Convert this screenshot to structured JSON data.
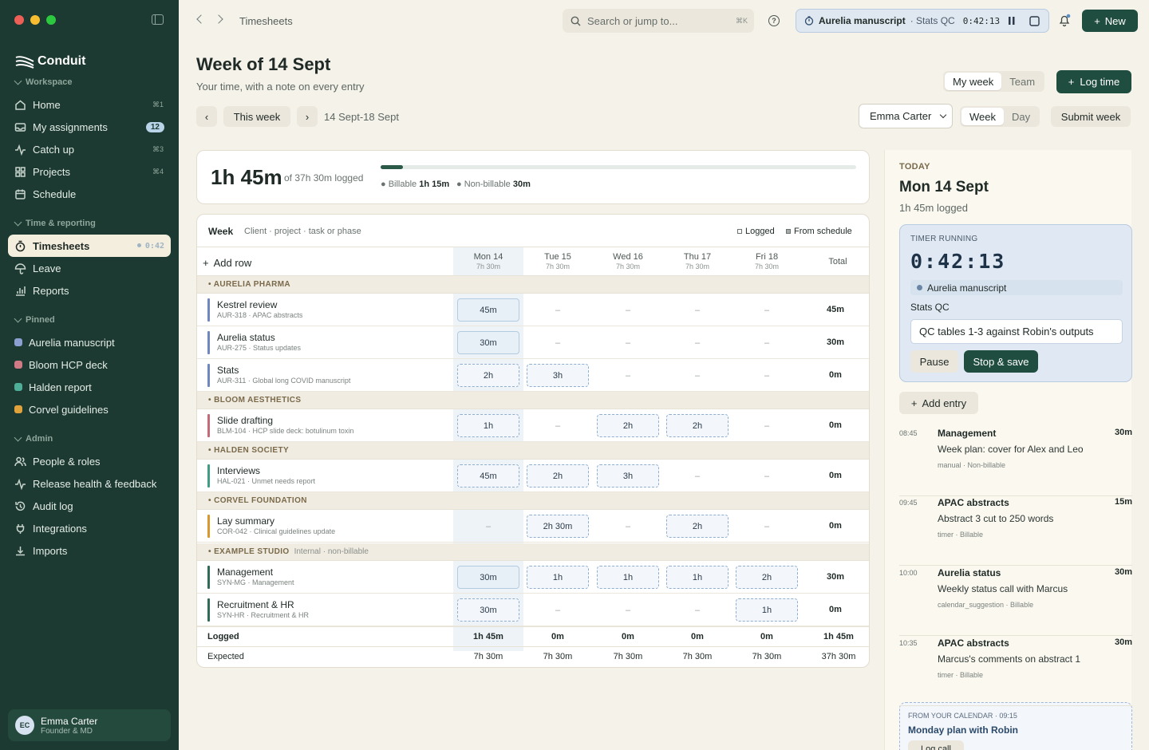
{
  "brand": {
    "name": "Conduit"
  },
  "sidebar": {
    "sections": {
      "workspace": "Workspace",
      "time": "Time & reporting",
      "pinned": "Pinned",
      "admin": "Admin"
    },
    "workspace": [
      {
        "label": "Home",
        "kbd": "⌘1",
        "icon": "home-icon"
      },
      {
        "label": "My assignments",
        "badge": "12",
        "icon": "inbox-icon"
      },
      {
        "label": "Catch up",
        "kbd": "⌘3",
        "icon": "pulse-icon"
      },
      {
        "label": "Projects",
        "kbd": "⌘4",
        "icon": "grid-icon"
      },
      {
        "label": "Schedule",
        "icon": "calendar-icon"
      }
    ],
    "time": [
      {
        "label": "Timesheets",
        "timer": "0:42",
        "icon": "timer-icon"
      },
      {
        "label": "Leave",
        "icon": "umbrella-icon"
      },
      {
        "label": "Reports",
        "icon": "chart-icon"
      }
    ],
    "pinned": [
      {
        "label": "Aurelia manuscript",
        "color": "#8b9fd1"
      },
      {
        "label": "Bloom HCP deck",
        "color": "#d07a86"
      },
      {
        "label": "Halden report",
        "color": "#4fae97"
      },
      {
        "label": "Corvel guidelines",
        "color": "#e0a33b"
      }
    ],
    "admin": [
      {
        "label": "People & roles",
        "icon": "people-icon"
      },
      {
        "label": "Release health & feedback",
        "icon": "pulse-icon"
      },
      {
        "label": "Audit log",
        "icon": "history-icon"
      },
      {
        "label": "Integrations",
        "icon": "plug-icon"
      },
      {
        "label": "Imports",
        "icon": "download-icon"
      }
    ],
    "user": {
      "initials": "EC",
      "name": "Emma Carter",
      "role": "Founder & MD"
    }
  },
  "topbar": {
    "crumb": "Timesheets",
    "search_placeholder": "Search or jump to...",
    "search_kbd": "⌘K",
    "timer_project": "Aurelia manuscript",
    "timer_task": "· Stats QC",
    "timer_clock": "0:42:13",
    "new_label": "New"
  },
  "page": {
    "title": "Week of 14 Sept",
    "subtitle": "Your time, with a note on every entry",
    "scope_tabs": [
      "My week",
      "Team"
    ],
    "log_time": "Log time",
    "this_week": "This week",
    "prev": "‹",
    "next": "›",
    "range": "14 Sept-18 Sept",
    "person": "Emma Carter",
    "view_tabs": [
      "Week",
      "Day"
    ],
    "submit": "Submit week"
  },
  "summary": {
    "logged": "1h 45m",
    "of": "of 37h 30m logged",
    "progress": 0.047,
    "billable_label": "Billable",
    "billable": "1h 15m",
    "nonbillable_label": "Non-billable",
    "nonbillable": "30m"
  },
  "grid": {
    "week_label": "Week",
    "columns_label": "Client · project · task or phase",
    "legend_logged": "Logged",
    "legend_schedule": "From schedule",
    "add_row": "Add row",
    "days": [
      {
        "name": "Mon 14",
        "hours": "7h 30m"
      },
      {
        "name": "Tue 15",
        "hours": "7h 30m"
      },
      {
        "name": "Wed 16",
        "hours": "7h 30m"
      },
      {
        "name": "Thu 17",
        "hours": "7h 30m"
      },
      {
        "name": "Fri 18",
        "hours": "7h 30m"
      }
    ],
    "total_label": "Total",
    "groups": [
      {
        "name": "• AURELIA PHARMA",
        "note": ""
      },
      {
        "name": "• BLOOM AESTHETICS",
        "note": ""
      },
      {
        "name": "• HALDEN SOCIETY",
        "note": ""
      },
      {
        "name": "• CORVEL FOUNDATION",
        "note": ""
      },
      {
        "name": "• EXAMPLE STUDIO",
        "note": "Internal · non-billable"
      }
    ],
    "rows": [
      {
        "title": "Kestrel review",
        "sub": "AUR-318 · APAC abstracts",
        "color": "#6f86c0",
        "cells": [
          "45m",
          "–",
          "–",
          "–",
          "–"
        ],
        "kinds": [
          "logged",
          "empty",
          "empty",
          "empty",
          "empty"
        ],
        "total": "45m"
      },
      {
        "title": "Aurelia status",
        "sub": "AUR-275 · Status updates",
        "color": "#6f86c0",
        "cells": [
          "30m",
          "–",
          "–",
          "–",
          "–"
        ],
        "kinds": [
          "logged",
          "empty",
          "empty",
          "empty",
          "empty"
        ],
        "total": "30m"
      },
      {
        "title": "Stats",
        "sub": "AUR-311 · Global long COVID manuscript",
        "color": "#6f86c0",
        "cells": [
          "2h",
          "3h",
          "–",
          "–",
          "–"
        ],
        "kinds": [
          "sched",
          "sched",
          "empty",
          "empty",
          "empty"
        ],
        "total": "0m"
      },
      {
        "title": "Slide drafting",
        "sub": "BLM-104 · HCP slide deck: botulinum toxin",
        "color": "#c56a78",
        "cells": [
          "1h",
          "–",
          "2h",
          "2h",
          "–"
        ],
        "kinds": [
          "sched",
          "empty",
          "sched",
          "sched",
          "empty"
        ],
        "total": "0m"
      },
      {
        "title": "Interviews",
        "sub": "HAL-021 · Unmet needs report",
        "color": "#3f9d86",
        "cells": [
          "45m",
          "2h",
          "3h",
          "–",
          "–"
        ],
        "kinds": [
          "sched",
          "sched",
          "sched",
          "empty",
          "empty"
        ],
        "total": "0m"
      },
      {
        "title": "Lay summary",
        "sub": "COR-042 · Clinical guidelines update",
        "color": "#d8982e",
        "cells": [
          "–",
          "2h 30m",
          "–",
          "2h",
          "–"
        ],
        "kinds": [
          "empty",
          "sched",
          "empty",
          "sched",
          "empty"
        ],
        "total": "0m"
      },
      {
        "title": "Management",
        "sub": "SYN-MG · Management",
        "color": "#2f6b56",
        "cells": [
          "30m",
          "1h",
          "1h",
          "1h",
          "2h"
        ],
        "kinds": [
          "logged",
          "sched",
          "sched",
          "sched",
          "sched"
        ],
        "total": "30m"
      },
      {
        "title": "Recruitment & HR",
        "sub": "SYN-HR · Recruitment & HR",
        "color": "#2f6b56",
        "cells": [
          "30m",
          "–",
          "–",
          "–",
          "1h"
        ],
        "kinds": [
          "sched",
          "empty",
          "empty",
          "empty",
          "sched"
        ],
        "total": "0m"
      }
    ],
    "logged_label": "Logged",
    "logged_values": [
      "1h 45m",
      "0m",
      "0m",
      "0m",
      "0m",
      "1h 45m"
    ],
    "expected_label": "Expected",
    "expected_values": [
      "7h 30m",
      "7h 30m",
      "7h 30m",
      "7h 30m",
      "7h 30m",
      "37h 30m"
    ]
  },
  "today": {
    "eyebrow": "TODAY",
    "date": "Mon 14 Sept",
    "logged": "1h 45m logged",
    "timer_label": "TIMER RUNNING",
    "clock": "0:42:13",
    "project": "Aurelia manuscript",
    "task": "Stats QC",
    "note": "QC tables 1-3 against Robin's outputs",
    "pause": "Pause",
    "stop": "Stop & save",
    "add_entry": "Add entry",
    "entries": [
      {
        "time": "08:45",
        "title": "Management",
        "dur": "30m",
        "desc": "Week plan: cover for Alex and Leo",
        "meta": "manual · Non-billable"
      },
      {
        "time": "09:45",
        "title": "APAC abstracts",
        "dur": "15m",
        "desc": "Abstract 3 cut to 250 words",
        "meta": "timer · Billable"
      },
      {
        "time": "10:00",
        "title": "Aurelia status",
        "dur": "30m",
        "desc": "Weekly status call with Marcus",
        "meta": "calendar_suggestion · Billable"
      },
      {
        "time": "10:35",
        "title": "APAC abstracts",
        "dur": "30m",
        "desc": "Marcus's comments on abstract 1",
        "meta": "timer · Billable"
      }
    ],
    "calendar_label": "FROM YOUR CALENDAR · 09:15",
    "calendar_title": "Monday plan with Robin",
    "calendar_btn": "Log call"
  },
  "colors": {
    "sidebar": "#1c3a31",
    "accent": "#1f4d3f",
    "timer": "#dfe8f3"
  }
}
